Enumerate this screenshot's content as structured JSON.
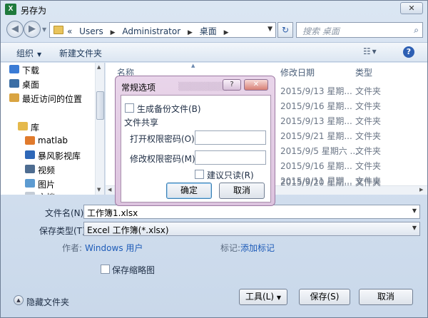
{
  "window": {
    "title": "另存为",
    "app_icon": "excel-icon",
    "close_label": "✕"
  },
  "address": {
    "crumbs": [
      "Users",
      "Administrator",
      "桌面"
    ],
    "prefix": "«",
    "search_placeholder": "搜索 桌面"
  },
  "toolbar": {
    "organize": "组织",
    "new_folder": "新建文件夹"
  },
  "nav_pane": {
    "items": [
      {
        "label": "下载",
        "icon": "download-folder-icon"
      },
      {
        "label": "桌面",
        "icon": "desktop-folder-icon"
      },
      {
        "label": "最近访问的位置",
        "icon": "recent-places-icon"
      },
      {
        "label": "库",
        "icon": "library-icon"
      },
      {
        "label": "matlab",
        "icon": "matlab-library-icon"
      },
      {
        "label": "暴风影视库",
        "icon": "storm-library-icon"
      },
      {
        "label": "视频",
        "icon": "video-library-icon"
      },
      {
        "label": "图片",
        "icon": "pictures-library-icon"
      },
      {
        "label": "文档",
        "icon": "documents-library-icon"
      }
    ]
  },
  "file_list": {
    "columns": {
      "name": "名称",
      "date": "修改日期",
      "type": "类型"
    },
    "rows": [
      {
        "date": "2015/9/13 星期...",
        "type": "文件夹"
      },
      {
        "date": "2015/9/16 星期...",
        "type": "文件夹"
      },
      {
        "date": "2015/9/13 星期...",
        "type": "文件夹"
      },
      {
        "date": "2015/9/21 星期...",
        "type": "文件夹"
      },
      {
        "date": "2015/9/5 星期六 ...",
        "type": "文件夹"
      },
      {
        "date": "2015/9/16 星期...",
        "type": "文件夹"
      },
      {
        "date": "2015/9/11 星期...",
        "type": "文件夹"
      },
      {
        "date": "2015/9/20 星期...",
        "type": "文件夹"
      }
    ]
  },
  "form": {
    "filename_label": "文件名(N):",
    "filename_value": "工作簿1.xlsx",
    "filetype_label": "保存类型(T):",
    "filetype_value": "Excel 工作簿(*.xlsx)",
    "author_label": "作者:",
    "author_value": "Windows 用户",
    "tags_label": "标记:",
    "tags_value": "添加标记",
    "thumbnail_label": "保存缩略图"
  },
  "bottom": {
    "hide_folders": "隐藏文件夹",
    "tools": "工具(L)",
    "save": "保存(S)",
    "cancel": "取消"
  },
  "dialog": {
    "title": "常规选项",
    "help_label": "?",
    "close_label": "✕",
    "backup_label": "生成备份文件(B)",
    "sharing_heading": "文件共享",
    "open_password_label": "打开权限密码(O):",
    "modify_password_label": "修改权限密码(M):",
    "readonly_label": "建议只读(R)",
    "ok": "确定",
    "cancel": "取消"
  },
  "colors": {
    "accent": "#2d5fb3",
    "dialog_frame": "#dcc3de",
    "link": "#1d5bb8"
  }
}
